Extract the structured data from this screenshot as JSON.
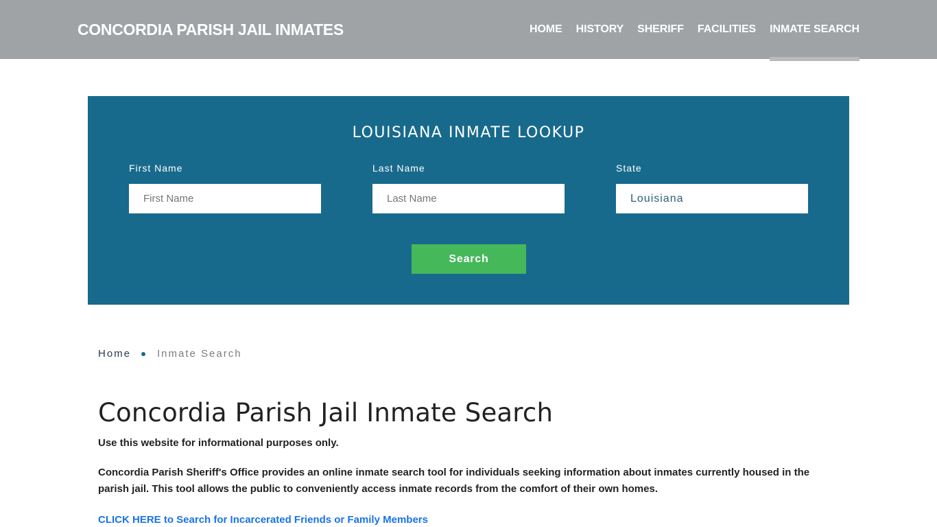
{
  "header": {
    "brand": "CONCORDIA PARISH JAIL INMATES",
    "nav": [
      {
        "label": "HOME",
        "active": false
      },
      {
        "label": "HISTORY",
        "active": false
      },
      {
        "label": "SHERIFF",
        "active": false
      },
      {
        "label": "FACILITIES",
        "active": false
      },
      {
        "label": "INMATE SEARCH",
        "active": true
      }
    ]
  },
  "lookup": {
    "title": "LOUISIANA INMATE LOOKUP",
    "first_name": {
      "label": "First Name",
      "placeholder": "First Name",
      "value": ""
    },
    "last_name": {
      "label": "Last Name",
      "placeholder": "Last Name",
      "value": ""
    },
    "state": {
      "label": "State",
      "value": "Louisiana"
    },
    "search_label": "Search"
  },
  "breadcrumb": {
    "home": "Home",
    "current": "Inmate Search"
  },
  "content": {
    "title": "Concordia Parish Jail Inmate Search",
    "intro": "Use this website for informational purposes only.",
    "description": "Concordia Parish Sheriff's Office provides an online inmate search tool for individuals seeking information about inmates currently housed in the parish jail. This tool allows the public to conveniently access inmate records from the comfort of their own homes.",
    "cta": "CLICK HERE to Search for Incarcerated Friends or Family Members"
  },
  "colors": {
    "header_bg": "#9fa3a6",
    "lookup_bg": "#186a8d",
    "button_bg": "#45b85a",
    "link": "#1a73e8"
  }
}
